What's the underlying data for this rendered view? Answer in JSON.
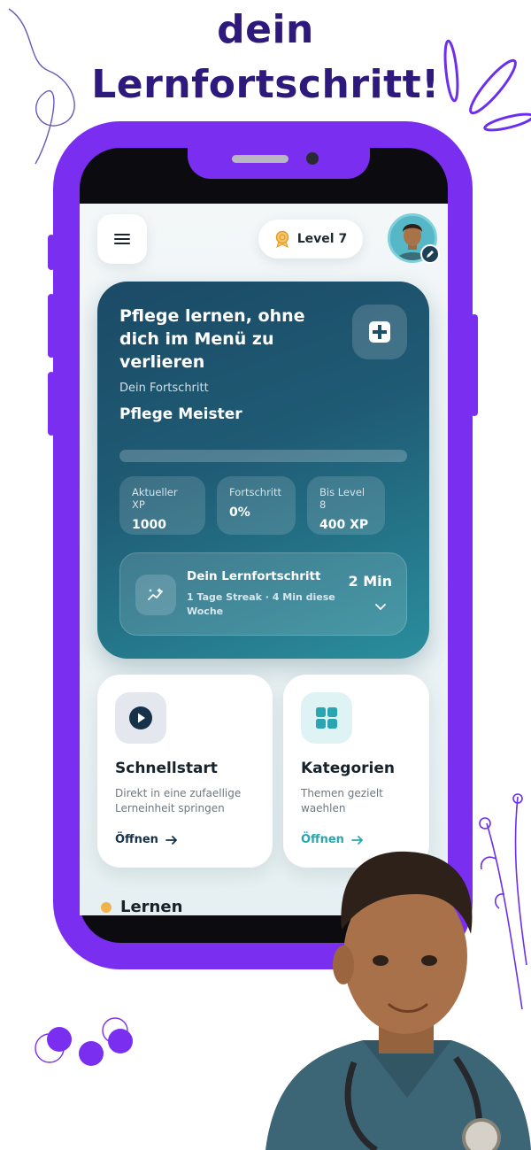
{
  "headline": {
    "line1": "dein",
    "line2": "Lernfortschritt!"
  },
  "header": {
    "level_label": "Level 7"
  },
  "hero": {
    "title": "Pflege lernen, ohne dich im Menü zu verlieren",
    "subtitle": "Dein Fortschritt",
    "rank": "Pflege Meister",
    "progress_fraction": 0,
    "stats": [
      {
        "label": "Aktueller XP",
        "value": "1000"
      },
      {
        "label": "Fortschritt",
        "value": "0%"
      },
      {
        "label": "Bis Level 8",
        "value": "400 XP"
      }
    ],
    "streak": {
      "title": "Dein Lernfortschritt",
      "subtitle": "1 Tage Streak · 4 Min diese Woche",
      "minutes": "2 Min"
    }
  },
  "cards": [
    {
      "title": "Schnellstart",
      "description": "Direkt in eine zufaellige Lerneinheit springen",
      "action": "Öffnen",
      "icon": "play-icon",
      "accent": "#15324a"
    },
    {
      "title": "Kategorien",
      "description": "Themen gezielt waehlen",
      "action": "Öffnen",
      "icon": "grid-icon",
      "accent": "#2aa6b2"
    }
  ],
  "section": {
    "title": "Lernen"
  },
  "colors": {
    "brand_purple": "#7a2ff0",
    "headline": "#2e1a7d",
    "hero_start": "#1b4a66",
    "hero_end": "#2a8e9d",
    "section_dot": "#f0b24a"
  }
}
